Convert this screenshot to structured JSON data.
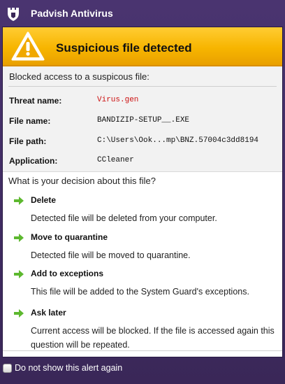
{
  "window": {
    "title": "Padvish Antivirus"
  },
  "banner": {
    "title": "Suspicious file detected"
  },
  "info": {
    "blocked_text": "Blocked access to a suspicous file:",
    "rows": [
      {
        "key": "Threat name:",
        "value": "Virus.gen"
      },
      {
        "key": "File name:",
        "value": "BANDIZIP-SETUP__.EXE"
      },
      {
        "key": "File path:",
        "value": "C:\\Users\\Ook...mp\\BNZ.57004c3dd8194"
      },
      {
        "key": "Application:",
        "value": "CCleaner"
      }
    ]
  },
  "decision": {
    "question": "What is your decision about this file?",
    "options": [
      {
        "label": "Delete",
        "desc": "Detected file will be deleted from your computer."
      },
      {
        "label": "Move to quarantine",
        "desc": "Detected file will be moved to quarantine."
      },
      {
        "label": "Add to exceptions",
        "desc": "This file will be added to the System Guard's exceptions."
      },
      {
        "label": "Ask later",
        "desc": "Current access will be blocked. If the file is accessed again this question will be repeated."
      }
    ]
  },
  "footer": {
    "checkbox_label": "Do not show this alert again",
    "checked": false
  },
  "colors": {
    "titlebar": "#3a2758",
    "banner": "#f7b500",
    "threat": "#cc1111",
    "arrow": "#5db82f"
  }
}
